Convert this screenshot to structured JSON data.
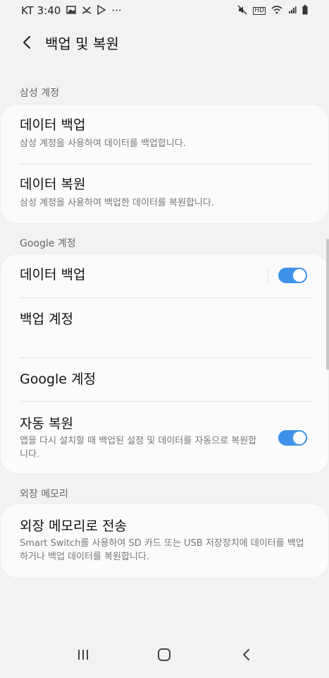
{
  "status_bar": {
    "carrier_time": "KT 3:40",
    "more": "···",
    "hd_label": "HD"
  },
  "header": {
    "title": "백업 및 복원"
  },
  "samsung_account": {
    "section_label": "삼성 계정",
    "backup_title": "데이터 백업",
    "backup_desc": "삼성 계정을 사용하여 데이터를 백업합니다.",
    "restore_title": "데이터 복원",
    "restore_desc": "삼성 계정을 사용하여 백업한 데이터를 복원합니다."
  },
  "google_account": {
    "section_label": "Google 계정",
    "backup_title": "데이터 백업",
    "backup_enabled": true,
    "backup_account_title": "백업 계정",
    "google_account_title": "Google 계정",
    "auto_restore_title": "자동 복원",
    "auto_restore_desc": "앱을 다시 설치할 때 백업된 설정 및 데이터를 자동으로 복원합니다.",
    "auto_restore_enabled": true
  },
  "external_storage": {
    "section_label": "외장 메모리",
    "transfer_title": "외장 메모리로 전송",
    "transfer_desc": "Smart Switch를 사용하여 SD 카드 또는 USB 저장장치에 데이터를 백업하거나 백업 데이터를 복원합니다."
  },
  "colors": {
    "toggle_on": "#3e91e8",
    "background": "#f2f2f2",
    "card": "#fbfbfb"
  }
}
